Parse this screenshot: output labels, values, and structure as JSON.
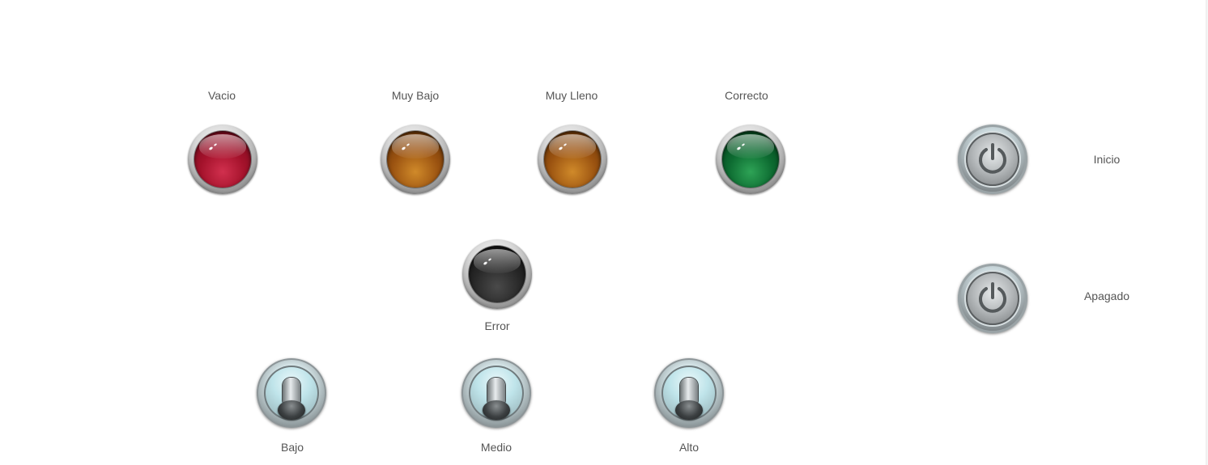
{
  "indicators": {
    "vacio": {
      "label": "Vacio",
      "color": "#a4122b"
    },
    "muy_bajo": {
      "label": "Muy Bajo",
      "color": "#9a5210"
    },
    "muy_lleno": {
      "label": "Muy Lleno",
      "color": "#9a5210"
    },
    "correcto": {
      "label": "Correcto",
      "color": "#0d6b31"
    },
    "error": {
      "label": "Error",
      "color": "#262626"
    }
  },
  "power_buttons": {
    "inicio": {
      "label": "Inicio",
      "icon": "power-icon"
    },
    "apagado": {
      "label": "Apagado",
      "icon": "power-icon"
    }
  },
  "toggles": {
    "bajo": {
      "label": "Bajo",
      "icon": "toggle-switch-icon"
    },
    "medio": {
      "label": "Medio",
      "icon": "toggle-switch-icon"
    },
    "alto": {
      "label": "Alto",
      "icon": "toggle-switch-icon"
    }
  }
}
